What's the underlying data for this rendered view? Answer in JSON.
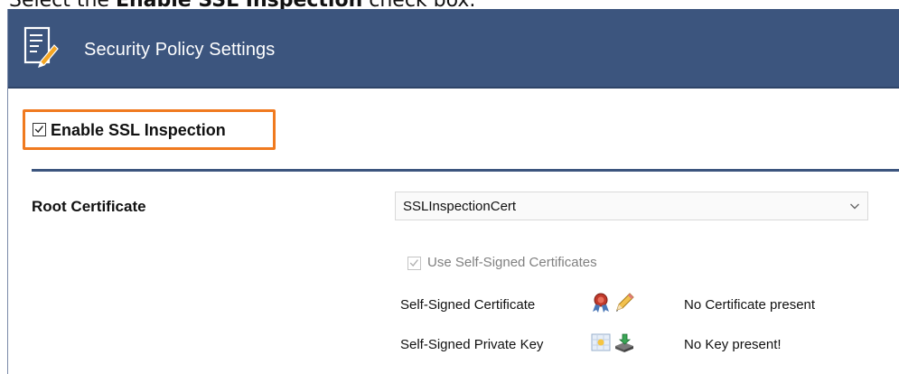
{
  "instruction": {
    "prefix": "Select the ",
    "emphasis": "Enable SSL Inspection",
    "suffix": " check box."
  },
  "window": {
    "title": "Security Policy Settings",
    "title_icon": "document-edit-icon"
  },
  "ssl_inspection": {
    "label": "Enable SSL Inspection",
    "checked": true,
    "highlight_color": "#f07a1f"
  },
  "root_certificate": {
    "label": "Root Certificate",
    "selected": "SSLInspectionCert"
  },
  "self_signed": {
    "checkbox_label": "Use Self-Signed Certificates",
    "checked": true,
    "certificate_label": "Self-Signed Certificate",
    "certificate_status": "No Certificate present",
    "private_key_label": "Self-Signed Private Key",
    "private_key_status": "No Key present!"
  },
  "colors": {
    "titlebar": "#3c557e",
    "accent": "#f07a1f"
  }
}
